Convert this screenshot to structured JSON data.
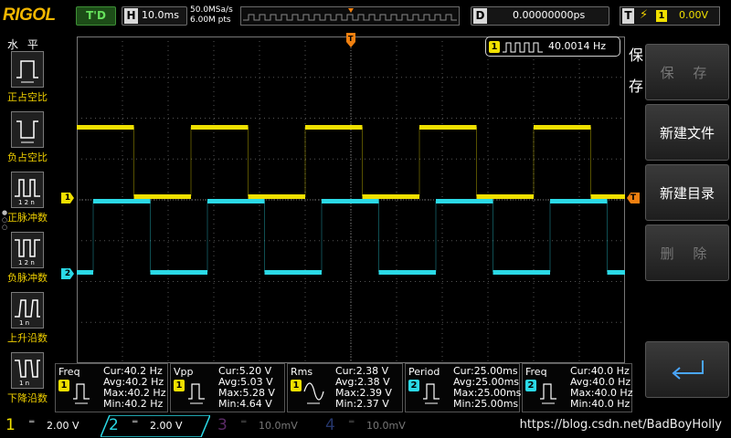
{
  "topbar": {
    "logo": "RIGOL",
    "run_state": "T'D",
    "timebase_key": "H",
    "timebase": "10.0ms",
    "sample_rate": "50.0MSa/s",
    "memory_depth": "6.00M pts",
    "delay_key": "D",
    "delay": "0.00000000ps",
    "trigger_key": "T",
    "trigger_source": "1",
    "trigger_level": "0.00V"
  },
  "left_menu": {
    "title": "水 平",
    "items": [
      {
        "label": "正占空比",
        "icon": "positive-duty-icon"
      },
      {
        "label": "负占空比",
        "icon": "negative-duty-icon"
      },
      {
        "label": "正脉冲数",
        "icon": "positive-pulse-count-icon"
      },
      {
        "label": "负脉冲数",
        "icon": "negative-pulse-count-icon"
      },
      {
        "label": "上升沿数",
        "icon": "rising-edge-count-icon"
      },
      {
        "label": "下降沿数",
        "icon": "falling-edge-count-icon"
      }
    ]
  },
  "screen": {
    "ch1_marker": "1",
    "ch2_marker": "2",
    "trigger_marker": "T",
    "freq_counter_channel": "1",
    "freq_counter": "40.0014 Hz"
  },
  "right_menu": {
    "title": "保存",
    "buttons": [
      {
        "label": "保 存",
        "enabled": false
      },
      {
        "label": "新建文件",
        "enabled": true
      },
      {
        "label": "新建目录",
        "enabled": true
      },
      {
        "label": "删 除",
        "enabled": false
      }
    ],
    "enter_icon": "enter-icon"
  },
  "measurements": [
    {
      "name": "Freq",
      "channel": "1",
      "color": "#f0e000",
      "cur": "Cur:40.2 Hz",
      "avg": "Avg:40.2 Hz",
      "max": "Max:40.2 Hz",
      "min": "Min:40.2 Hz"
    },
    {
      "name": "Vpp",
      "channel": "1",
      "color": "#f0e000",
      "cur": "Cur:5.20 V",
      "avg": "Avg:5.03 V",
      "max": "Max:5.28 V",
      "min": "Min:4.64 V"
    },
    {
      "name": "Rms",
      "channel": "1",
      "color": "#f0e000",
      "cur": "Cur:2.38 V",
      "avg": "Avg:2.38 V",
      "max": "Max:2.39 V",
      "min": "Min:2.37 V"
    },
    {
      "name": "Period",
      "channel": "2",
      "color": "#2bd9e6",
      "cur": "Cur:25.00ms",
      "avg": "Avg:25.00ms",
      "max": "Max:25.00ms",
      "min": "Min:25.00ms"
    },
    {
      "name": "Freq",
      "channel": "2",
      "color": "#2bd9e6",
      "cur": "Cur:40.0 Hz",
      "avg": "Avg:40.0 Hz",
      "max": "Max:40.0 Hz",
      "min": "Min:40.0 Hz"
    }
  ],
  "channels": [
    {
      "num": "1",
      "coupling": "═",
      "scale": "2.00 V",
      "color": "#f0e000",
      "active": true
    },
    {
      "num": "2",
      "coupling": "═",
      "scale": "2.00 V",
      "color": "#2bd9e6",
      "active": true
    },
    {
      "num": "3",
      "coupling": "═",
      "scale": "10.0mV",
      "color": "#b040c0",
      "active": false
    },
    {
      "num": "4",
      "coupling": "═",
      "scale": "10.0mV",
      "color": "#3060e0",
      "active": false
    }
  ],
  "watermark": "https://blog.csdn.net/BadBoyHolly",
  "colors": {
    "ch1": "#f0e000",
    "ch2": "#2bd9e6",
    "trigger": "#f08010",
    "accent": "#f0d000"
  }
}
